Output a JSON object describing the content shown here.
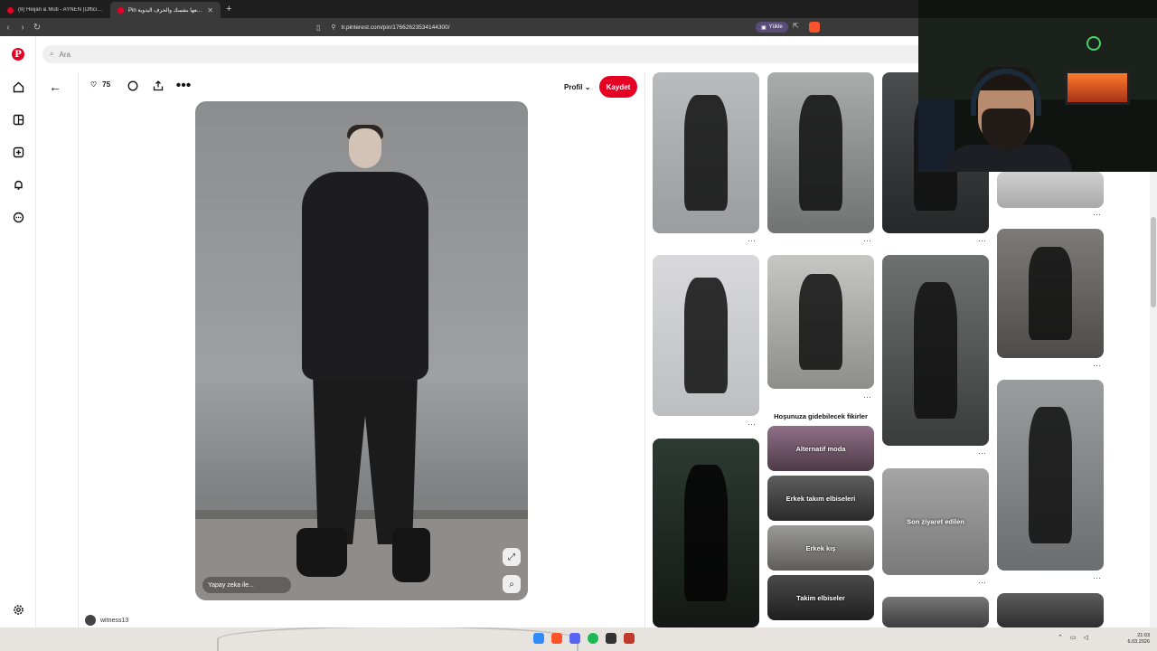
{
  "browser": {
    "tabs": [
      {
        "title": "(8) Heijan & Muti - AYNEN (Official V",
        "active": false
      },
      {
        "title": "Pin اصنعها بنفسك والحرف اليدوية",
        "active": true
      }
    ],
    "url": "tr.pinterest.com/pin/17662623534144300/",
    "install_label": "Yükle"
  },
  "search": {
    "placeholder": "Ara"
  },
  "pin": {
    "likes": "75",
    "profile_label": "Profil",
    "save_label": "Kaydet",
    "ai_label": "Yapay zeka ile...",
    "author": "witness13"
  },
  "ideas": {
    "title": "Hoşunuza gidebilecek fikirler",
    "items": [
      "Alternatif moda",
      "Erkek takım elbiseleri",
      "Erkek kış",
      "Takim elbiseler"
    ]
  },
  "grid_labels": {
    "recent": "Son ziyaret edilen"
  },
  "taskbar": {
    "time": "21:03",
    "date": "6.03.2026"
  },
  "colors": {
    "brand": "#e60023"
  }
}
